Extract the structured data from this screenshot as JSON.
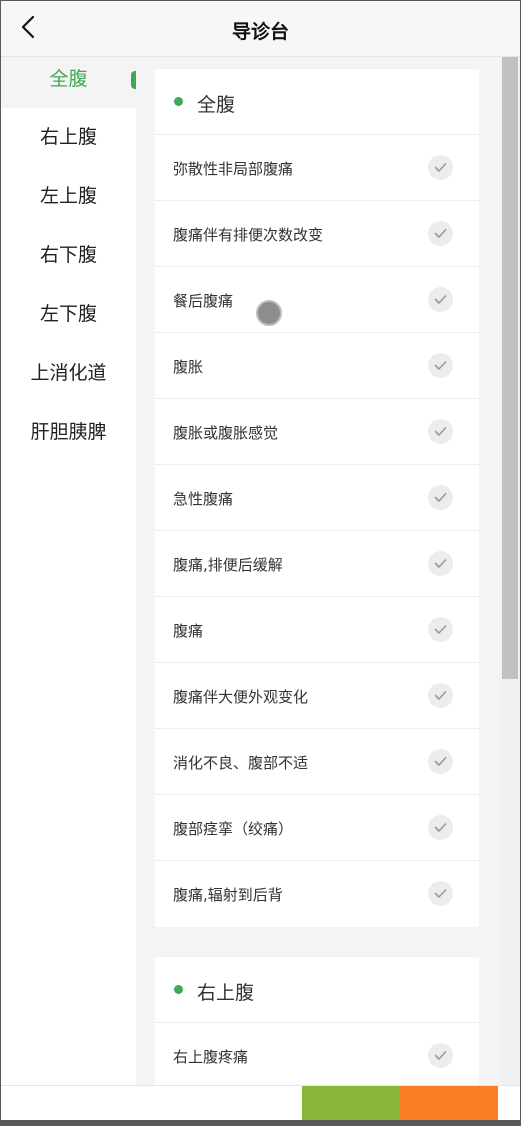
{
  "header": {
    "title": "导诊台",
    "back_icon": "chevron-left-icon"
  },
  "sidebar": {
    "items": [
      {
        "label": "全腹",
        "active": true
      },
      {
        "label": "右上腹"
      },
      {
        "label": "左上腹"
      },
      {
        "label": "右下腹"
      },
      {
        "label": "左下腹"
      },
      {
        "label": "上消化道"
      },
      {
        "label": "肝胆胰脾"
      }
    ],
    "accent_color": "#3da855"
  },
  "sections": [
    {
      "title": "全腹",
      "items": [
        "弥散性非局部腹痛",
        "腹痛伴有排便次数改变",
        "餐后腹痛",
        "腹胀",
        "腹胀或腹胀感觉",
        "急性腹痛",
        "腹痛,排便后缓解",
        "腹痛",
        "腹痛伴大便外观变化",
        "消化不良、腹部不适",
        "腹部痉挛（绞痛）",
        "腹痛,辐射到后背"
      ]
    },
    {
      "title": "右上腹",
      "items": [
        "右上腹疼痛"
      ]
    }
  ],
  "check_icon": "check-icon",
  "bottom_bar": {
    "green_color": "#8ab53a",
    "orange_color": "#fa7f24"
  }
}
